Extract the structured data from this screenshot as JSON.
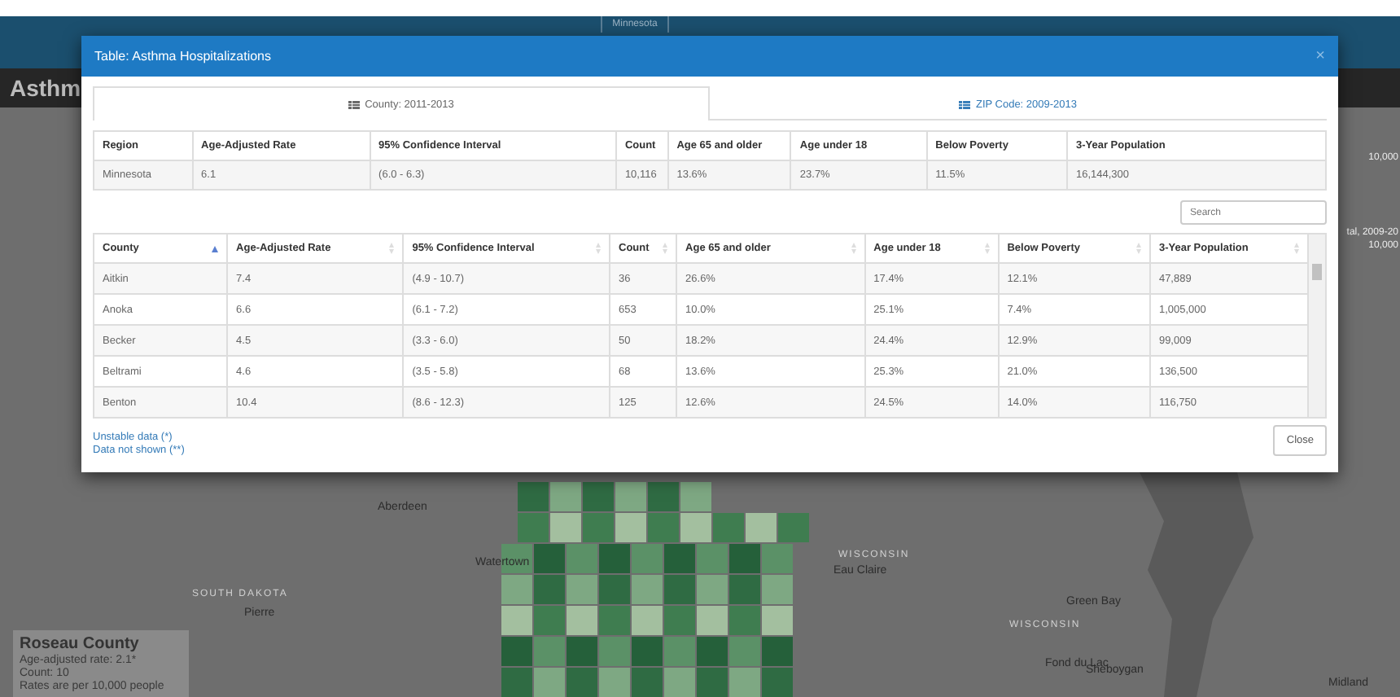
{
  "header": {
    "site_title": "Minnesota"
  },
  "page_title": "Asthm",
  "legend_fragments": [
    "10,000",
    "tal, 2009-20",
    "10,000"
  ],
  "map_labels": [
    {
      "text": "Aberdeen",
      "kind": "city"
    },
    {
      "text": "Watertown",
      "kind": "city"
    },
    {
      "text": "SOUTH DAKOTA",
      "kind": "state"
    },
    {
      "text": "Pierre",
      "kind": "city"
    },
    {
      "text": "WISCONSIN",
      "kind": "state"
    },
    {
      "text": "Eau Claire",
      "kind": "city"
    },
    {
      "text": "Green Bay",
      "kind": "city"
    },
    {
      "text": "WISCONSIN",
      "kind": "state"
    },
    {
      "text": "Fond du Lac",
      "kind": "city"
    },
    {
      "text": "Sheboygan",
      "kind": "city"
    },
    {
      "text": "Midland",
      "kind": "city"
    }
  ],
  "info_box": {
    "title": "Roseau County",
    "lines": [
      "Age-adjusted rate: 2.1*",
      "Count: 10"
    ],
    "note": "Rates are per 10,000 people"
  },
  "modal": {
    "title": "Table: Asthma Hospitalizations",
    "close_glyph": "×",
    "tabs": [
      {
        "label": "County: 2011-2013",
        "selected": true
      },
      {
        "label": "ZIP Code: 2009-2013",
        "selected": false
      }
    ],
    "summary": {
      "columns": [
        "Region",
        "Age-Adjusted Rate",
        "95% Confidence Interval",
        "Count",
        "Age 65 and older",
        "Age under 18",
        "Below Poverty",
        "3-Year Population"
      ],
      "rows": [
        [
          "Minnesota",
          "6.1",
          "(6.0 - 6.3)",
          "10,116",
          "13.6%",
          "23.7%",
          "11.5%",
          "16,144,300"
        ]
      ]
    },
    "search": {
      "placeholder": "Search"
    },
    "table": {
      "columns": [
        {
          "label": "County",
          "sorted": true
        },
        {
          "label": "Age-Adjusted Rate",
          "sorted": false
        },
        {
          "label": "95% Confidence Interval",
          "sorted": false
        },
        {
          "label": "Count",
          "sorted": false
        },
        {
          "label": "Age 65 and older",
          "sorted": false
        },
        {
          "label": "Age under 18",
          "sorted": false
        },
        {
          "label": "Below Poverty",
          "sorted": false
        },
        {
          "label": "3-Year Population",
          "sorted": false
        }
      ],
      "rows": [
        [
          "Aitkin",
          "7.4",
          "(4.9 - 10.7)",
          "36",
          "26.6%",
          "17.4%",
          "12.1%",
          "47,889"
        ],
        [
          "Anoka",
          "6.6",
          "(6.1 - 7.2)",
          "653",
          "10.0%",
          "25.1%",
          "7.4%",
          "1,005,000"
        ],
        [
          "Becker",
          "4.5",
          "(3.3 - 6.0)",
          "50",
          "18.2%",
          "24.4%",
          "12.9%",
          "99,009"
        ],
        [
          "Beltrami",
          "4.6",
          "(3.5 - 5.8)",
          "68",
          "13.6%",
          "25.3%",
          "21.0%",
          "136,500"
        ],
        [
          "Benton",
          "10.4",
          "(8.6 - 12.3)",
          "125",
          "12.6%",
          "24.5%",
          "14.0%",
          "116,750"
        ]
      ]
    },
    "footnotes": [
      "Unstable data (*)",
      "Data not shown (**)"
    ],
    "buttons": [
      "Close"
    ]
  }
}
